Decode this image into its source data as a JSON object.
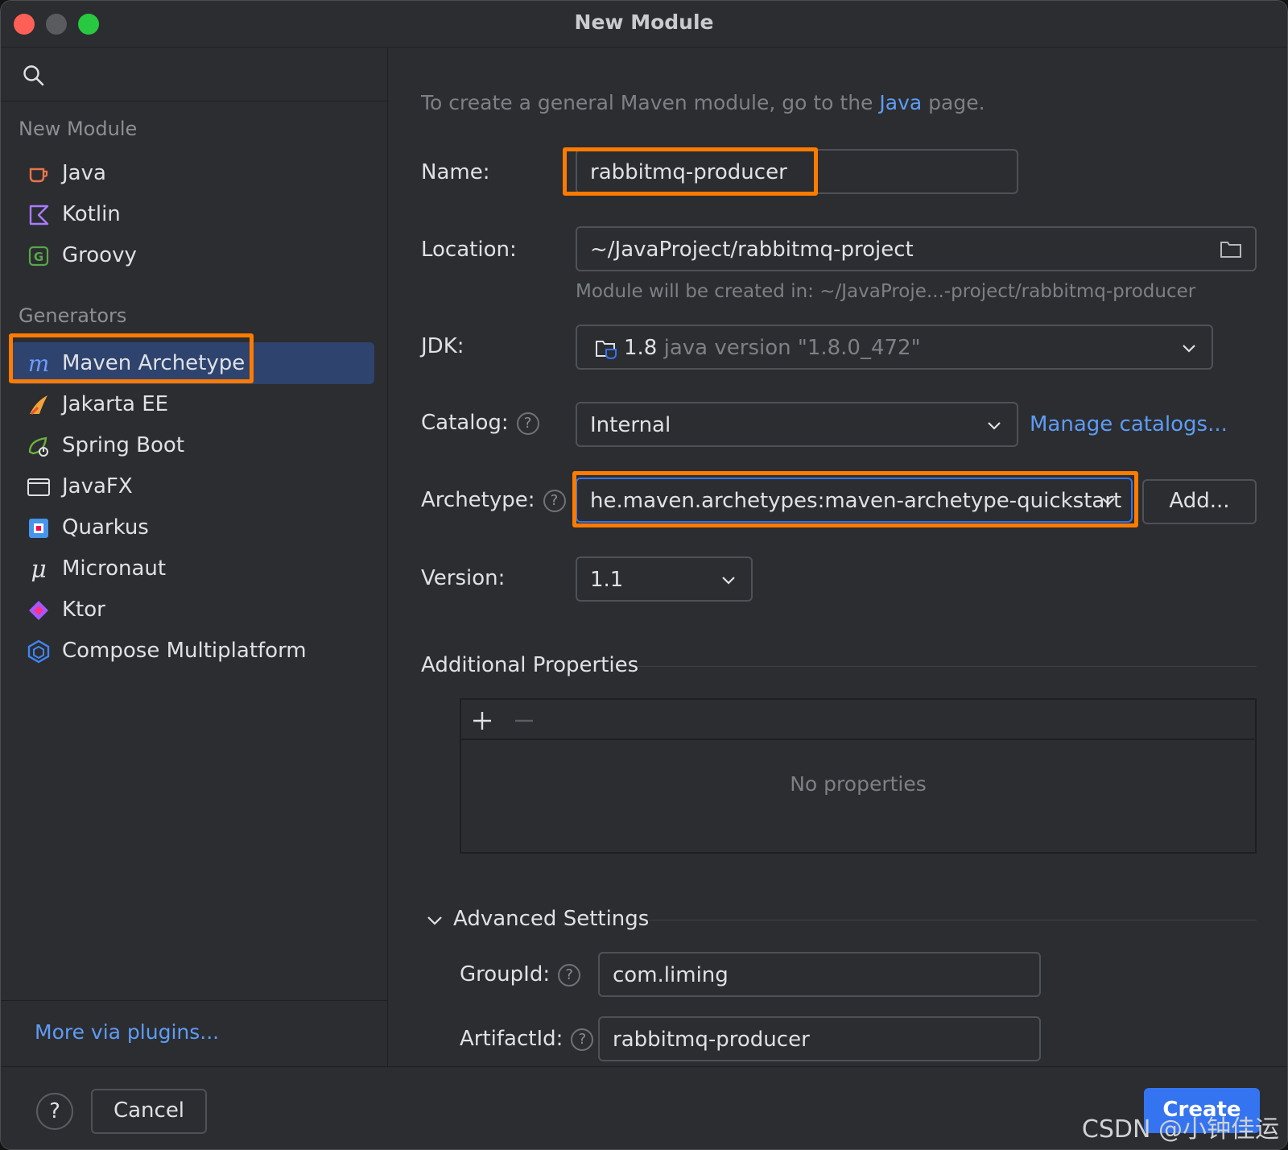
{
  "window": {
    "title": "New Module"
  },
  "sidebar": {
    "new_module_header": "New Module",
    "new_module_items": [
      {
        "label": "Java",
        "icon": "java-cup-icon"
      },
      {
        "label": "Kotlin",
        "icon": "kotlin-icon"
      },
      {
        "label": "Groovy",
        "icon": "groovy-icon"
      }
    ],
    "generators_header": "Generators",
    "generator_items": [
      {
        "label": "Maven Archetype",
        "icon": "maven-icon",
        "selected": true
      },
      {
        "label": "Jakarta EE",
        "icon": "jakarta-ee-icon"
      },
      {
        "label": "Spring Boot",
        "icon": "spring-boot-icon"
      },
      {
        "label": "JavaFX",
        "icon": "javafx-window-icon"
      },
      {
        "label": "Quarkus",
        "icon": "quarkus-icon"
      },
      {
        "label": "Micronaut",
        "icon": "micronaut-icon"
      },
      {
        "label": "Ktor",
        "icon": "ktor-icon"
      },
      {
        "label": "Compose Multiplatform",
        "icon": "compose-multiplatform-icon"
      }
    ],
    "plugins_link": "More via plugins..."
  },
  "main": {
    "hint_prefix": "To create a general Maven module, go to the ",
    "hint_link": "Java",
    "hint_suffix": " page.",
    "name_label": "Name:",
    "name_value": "rabbitmq-producer",
    "location_label": "Location:",
    "location_value": "~/JavaProject/rabbitmq-project",
    "location_hint": "Module will be created in: ~/JavaProje...-project/rabbitmq-producer",
    "jdk_label": "JDK:",
    "jdk_version": "1.8",
    "jdk_detail": "java version \"1.8.0_472\"",
    "catalog_label": "Catalog:",
    "catalog_value": "Internal",
    "manage_catalogs": "Manage catalogs...",
    "archetype_label": "Archetype:",
    "archetype_value": "he.maven.archetypes:maven-archetype-quickstart",
    "add_button": "Add...",
    "version_label": "Version:",
    "version_value": "1.1",
    "additional_properties_title": "Additional Properties",
    "no_properties": "No properties",
    "advanced_settings_title": "Advanced Settings",
    "groupid_label": "GroupId:",
    "groupid_value": "com.liming",
    "artifactid_label": "ArtifactId:",
    "artifactid_value": "rabbitmq-producer"
  },
  "footer": {
    "help_symbol": "?",
    "cancel_label": "Cancel",
    "create_label": "Create",
    "watermark": "CSDN @小钟佳运"
  },
  "colors": {
    "accent": "#3574f0",
    "highlight": "#ff7b00",
    "link": "#5e9cf5",
    "selected_row": "#2e436e"
  }
}
